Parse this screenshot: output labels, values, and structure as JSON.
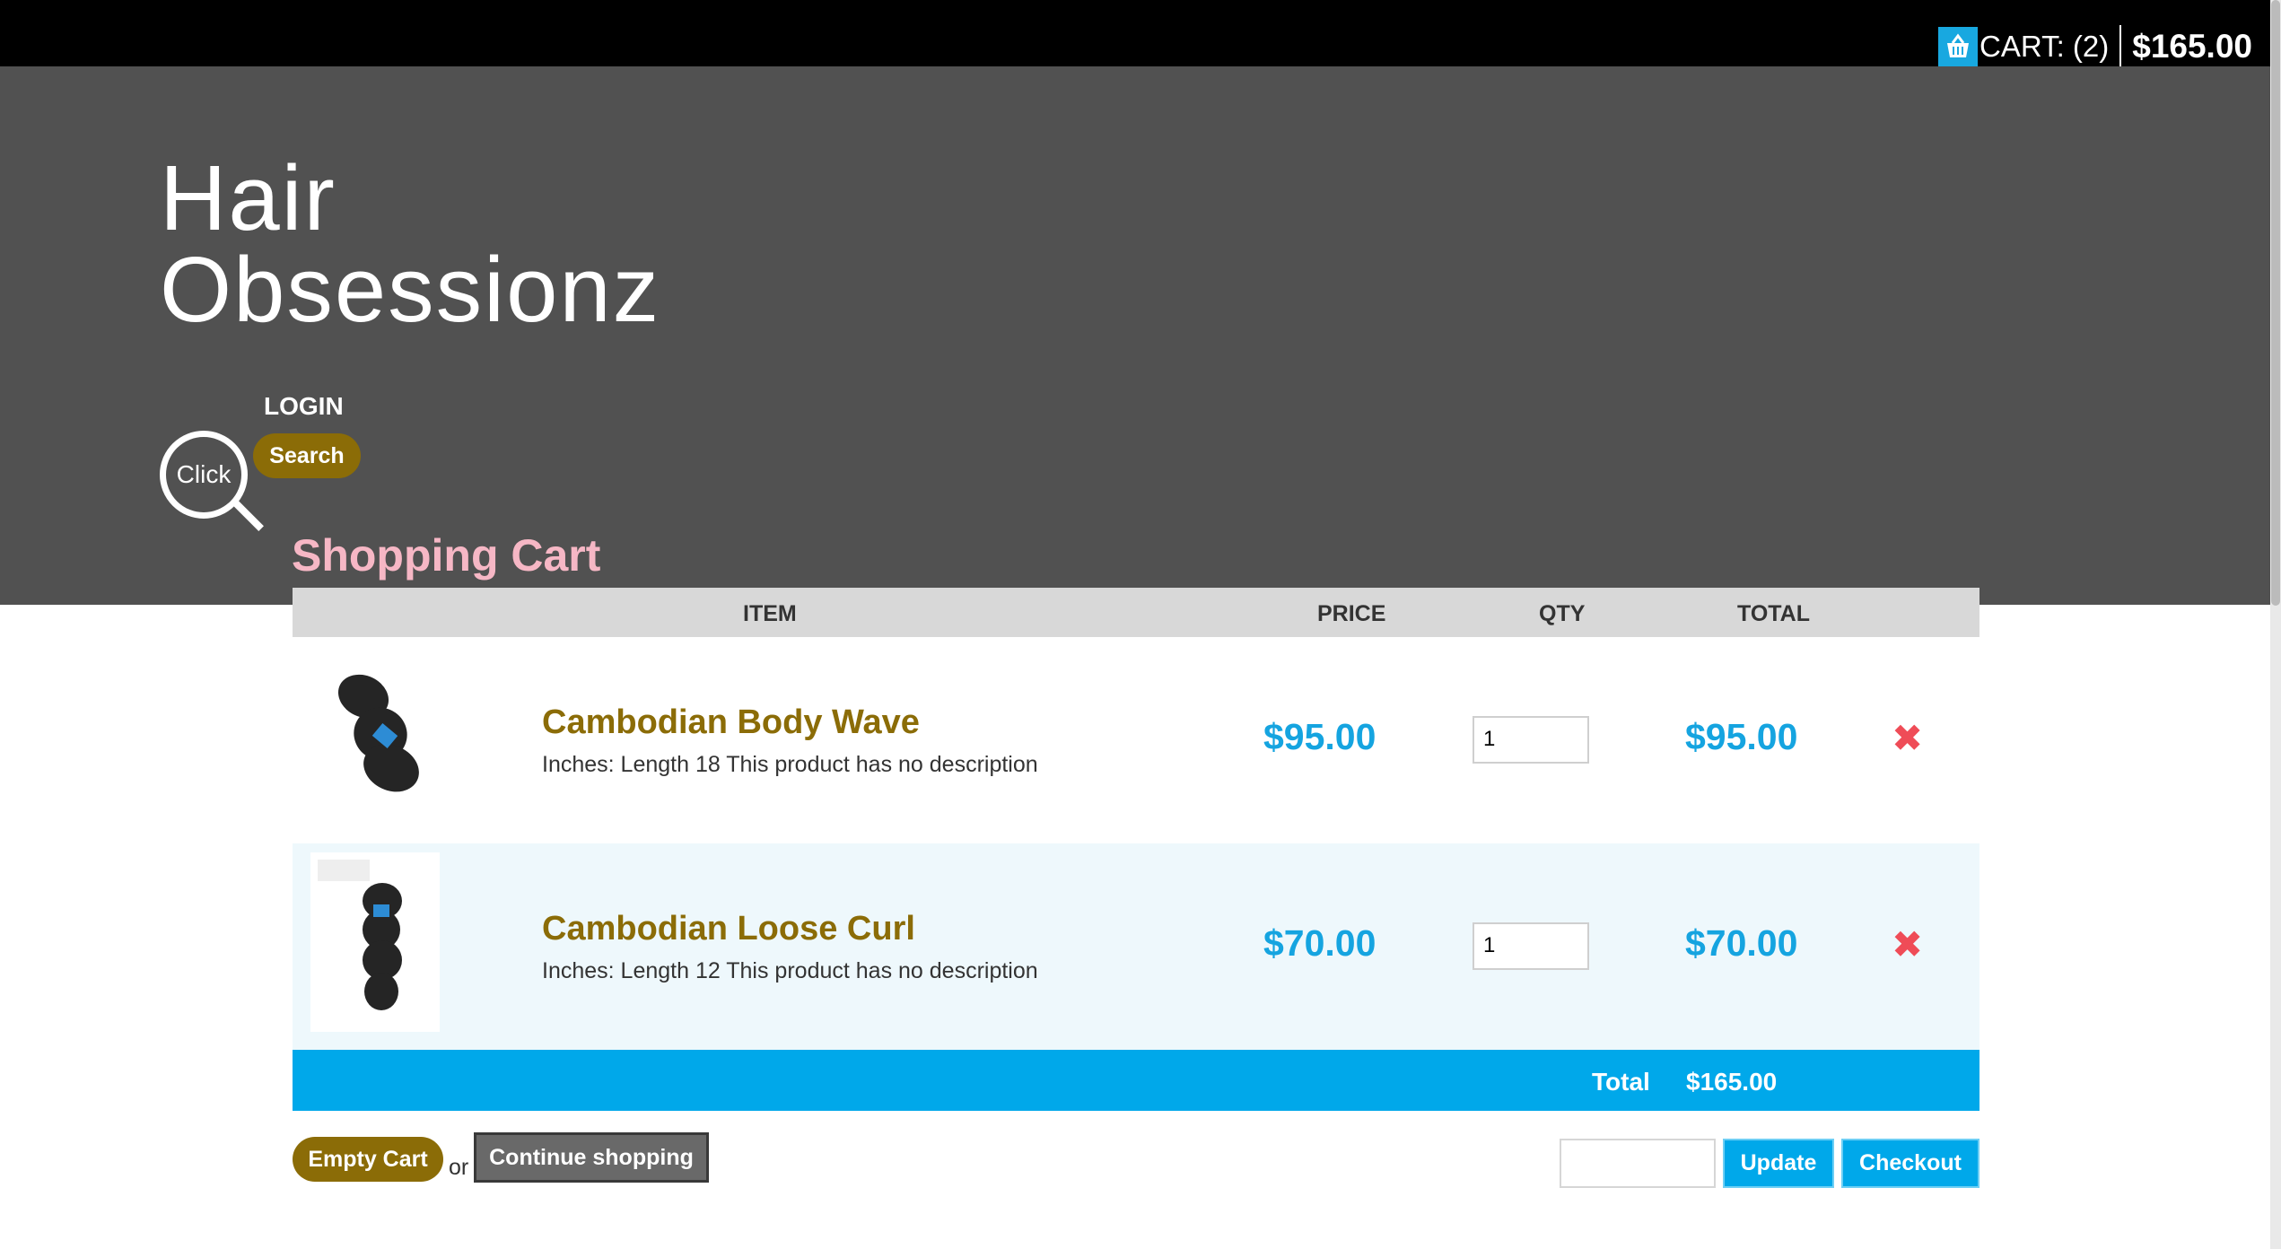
{
  "cart_summary": {
    "label": "CART: (2)",
    "total": "$165.00",
    "icon": "basket-icon"
  },
  "brand": {
    "line1": "Hair",
    "line2": "Obsessionz"
  },
  "nav": {
    "login": "LOGIN",
    "search": "Search",
    "click": "Click"
  },
  "page": {
    "title": "Shopping Cart"
  },
  "table": {
    "headers": {
      "item": "ITEM",
      "price": "PRICE",
      "qty": "QTY",
      "total": "TOTAL"
    }
  },
  "items": [
    {
      "name": "Cambodian Body Wave",
      "desc": "Inches: Length 18 This product has no description",
      "price": "$95.00",
      "qty": "1",
      "total": "$95.00",
      "remove": "✖"
    },
    {
      "name": "Cambodian Loose Curl",
      "desc": "Inches: Length 12 This product has no description",
      "price": "$70.00",
      "qty": "1",
      "total": "$70.00",
      "remove": "✖"
    }
  ],
  "summary": {
    "label": "Total",
    "value": "$165.00"
  },
  "actions": {
    "empty": "Empty Cart",
    "or": "or",
    "continue": "Continue shopping",
    "update": "Update",
    "checkout": "Checkout",
    "coupon_value": ""
  },
  "colors": {
    "accent_blue": "#00a8ea",
    "gold": "#8b6c07",
    "title_pink": "#f6b7c5",
    "remove_red": "#ef4c57"
  }
}
